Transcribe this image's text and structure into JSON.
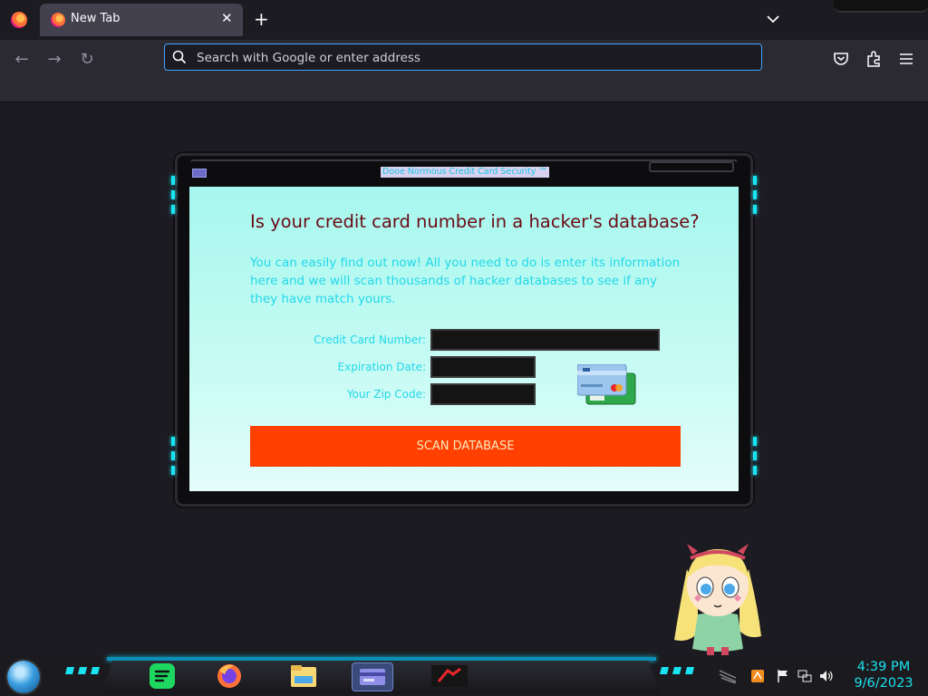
{
  "browser": {
    "tab": {
      "title": "New Tab",
      "close_glyph": "✕"
    },
    "new_tab_glyph": "+",
    "urlbar": {
      "placeholder": "Search with Google or enter address",
      "value": ""
    },
    "nav": {
      "back_glyph": "←",
      "forward_glyph": "→",
      "reload_glyph": "↻"
    },
    "icons": [
      "firefox-icon",
      "chevron-down-icon",
      "search-icon",
      "pocket-icon",
      "extensions-icon",
      "menu-icon"
    ]
  },
  "scam_window": {
    "title": "Dooe Normous Credit Card Security ™",
    "headline": "Is your credit card number in a hacker's database?",
    "intro": "You can easily find out now! All you need to do is enter its information here and we will scan thousands of hacker databases to see if any they have match yours.",
    "fields": {
      "card_number_label": "Credit Card Number:",
      "expiration_label": "Expiration Date:",
      "zip_label": "Your Zip Code:",
      "card_number_value": "",
      "expiration_value": "",
      "zip_value": ""
    },
    "scan_button": "SCAN DATABASE",
    "colors": {
      "panel": "#a6f7ee",
      "headline": "#6b0a14",
      "text": "#22d8ea",
      "button": "#ff4000"
    }
  },
  "taskbar": {
    "apps": [
      "spotify-icon",
      "firefox-icon",
      "file-explorer-icon",
      "credit-card-app-icon",
      "game-icon"
    ],
    "tray": [
      "app-tray-icon",
      "flag-icon",
      "network-icon",
      "volume-icon"
    ],
    "clock": {
      "time": "4:39 PM",
      "date": "9/6/2023"
    },
    "accent_color": "#19e3f0"
  }
}
